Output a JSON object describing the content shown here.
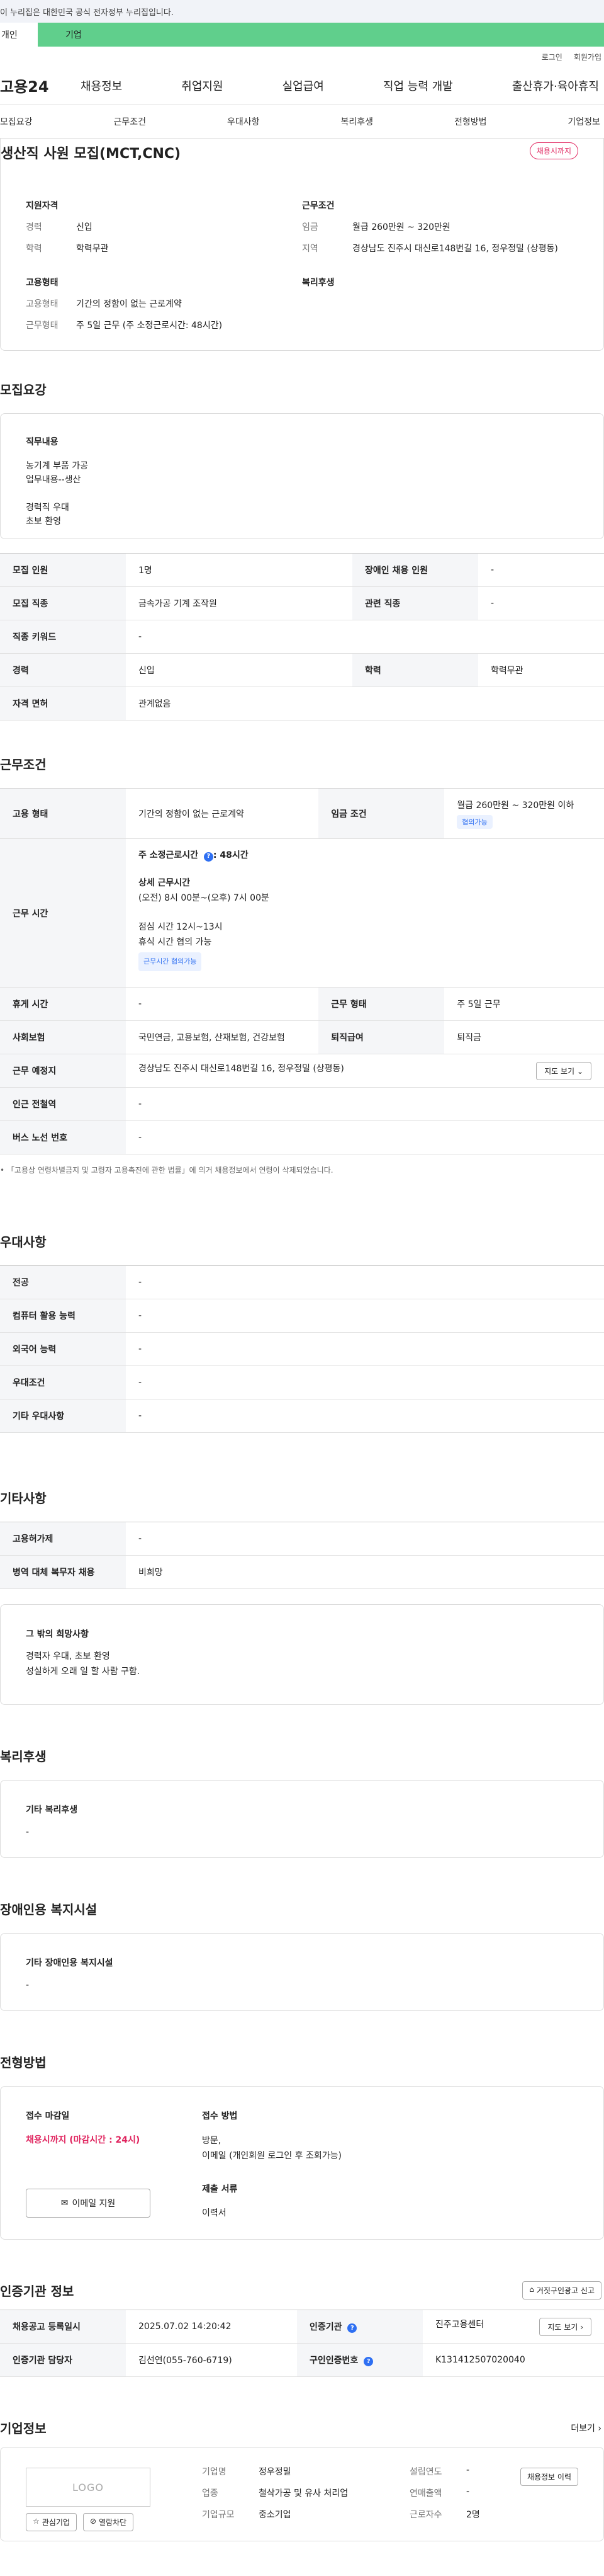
{
  "header": {
    "gov_banner": "이 누리집은 대한민국 공식 전자정부 누리집입니다.",
    "tab_individual": "개인",
    "tab_company": "기업",
    "login": "로그인",
    "signup": "회원가입",
    "logo": "고용24",
    "menu": [
      "채용정보",
      "취업지원",
      "실업급여",
      "직업 능력 개발",
      "출산휴가·육아휴직"
    ]
  },
  "subnav": [
    "모집요강",
    "근무조건",
    "우대사항",
    "복리후생",
    "전형방법",
    "기업정보"
  ],
  "summary": {
    "title": "생산직 사원 모집(MCT,CNC)",
    "badge": "채용시까지",
    "qual_title": "지원자격",
    "career_label": "경력",
    "career": "신입",
    "edu_label": "학력",
    "edu": "학력무관",
    "cond_title": "근무조건",
    "wage_label": "임금",
    "wage": "월급 260만원 ~ 320만원",
    "region_label": "지역",
    "region": "경상남도 진주시 대신로148번길 16, 정우정밀 (상평동)",
    "emp_title": "고용형태",
    "type_label": "고용형태",
    "type": "기간의 정함이 없는 근로계약",
    "shift_label": "근무형태",
    "shift": "주 5일 근무 (주 소정근로시간: 48시간)",
    "welfare_title": "복리후생"
  },
  "recruit": {
    "title": "모집요강",
    "job_title": "직무내용",
    "job_lines": [
      "농기계 부품 가공",
      "업무내용--생산",
      "",
      "경력직 우대",
      "초보 환영"
    ],
    "rows": [
      {
        "k1": "모집 인원",
        "v1": "1명",
        "k2": "장애인 채용 인원",
        "v2": "-"
      },
      {
        "k1": "모집 직종",
        "v1": "금속가공 기계 조작원",
        "k2": "관련 직종",
        "v2": "-"
      },
      {
        "k1": "직종 키워드",
        "v1": "-"
      },
      {
        "k1": "경력",
        "v1": "신입",
        "k2": "학력",
        "v2": "학력무관"
      },
      {
        "k1": "자격 면허",
        "v1": "관계없음"
      }
    ]
  },
  "conditions": {
    "title": "근무조건",
    "emp_type_k": "고용 형태",
    "emp_type_v": "기간의 정함이 없는 근로계약",
    "wage_k": "임금 조건",
    "wage_v": "월급 260만원 ~ 320만원 이하",
    "wage_tag": "협의가능",
    "hours_k": "근무 시간",
    "hours_main": "주 소정근로시간",
    "hours_value": ": 48시간",
    "detail_title": "상세 근무시간",
    "detail_time": "(오전) 8시 00분~(오후) 7시 00분",
    "lunch": "점심 시간 12시~13시",
    "break": "휴식 시간 협의 가능",
    "hours_tag": "근무시간 협의가능",
    "rest_k": "휴게 시간",
    "rest_v": "-",
    "shift_k": "근무 형태",
    "shift_v": "주 5일 근무",
    "insurance_k": "사회보험",
    "insurance_v": "국민연금, 고용보험, 산재보험, 건강보험",
    "severance_k": "퇴직급여",
    "severance_v": "퇴직금",
    "place_k": "근무 예정지",
    "place_v": "경상남도 진주시 대신로148번길 16, 정우정밀 (상평동)",
    "map_btn": "지도 보기",
    "subway_k": "인근 전철역",
    "subway_v": "-",
    "bus_k": "버스 노선 번호",
    "bus_v": "-",
    "note": "「고용상 연령차별금지 및 고령자 고용촉진에 관한 법률」에 의거 채용정보에서 연령이 삭제되었습니다."
  },
  "preference": {
    "title": "우대사항",
    "rows": [
      {
        "k": "전공",
        "v": "-"
      },
      {
        "k": "컴퓨터 활용 능력",
        "v": "-"
      },
      {
        "k": "외국어 능력",
        "v": "-"
      },
      {
        "k": "우대조건",
        "v": "-"
      },
      {
        "k": "기타 우대사항",
        "v": "-"
      }
    ]
  },
  "etc": {
    "title": "기타사항",
    "rows": [
      {
        "k": "고용허가제",
        "v": "-"
      },
      {
        "k": "병역 대체 복무자 채용",
        "v": "비희망"
      }
    ],
    "wish_title": "그 밖의 희망사항",
    "wish_lines": [
      "경력자 우대, 초보 환영",
      "성실하게 오래 일 할 사람 구함."
    ]
  },
  "welfare": {
    "title": "복리후생",
    "box_title": "기타 복리후생",
    "box_value": "-"
  },
  "disability": {
    "title": "장애인용 복지시설",
    "box_title": "기타 장애인용 복지시설",
    "box_value": "-"
  },
  "selection": {
    "title": "전형방법",
    "deadline_title": "접수 마감일",
    "deadline": "채용시까지 (마감시간 : 24시)",
    "method_title": "접수 방법",
    "method_lines": [
      "방문,",
      "이메일 (개인회원 로그인 후 조회가능)"
    ],
    "docs_title": "제출 서류",
    "docs": "이력서",
    "email_btn": "이메일 지원"
  },
  "agency": {
    "title": "인증기관 정보",
    "report_btn": "거짓구인광고 신고",
    "reg_k": "채용공고 등록일시",
    "reg_v": "2025.07.02 14:20:42",
    "org_k": "인증기관",
    "org_v": "진주고용센터",
    "map_btn": "지도 보기",
    "staff_k": "인증기관 담당자",
    "staff_v": "김선연(055-760-6719)",
    "no_k": "구인인증번호",
    "no_v": "K131412507020040"
  },
  "company": {
    "title": "기업정보",
    "more": "더보기",
    "logo_placeholder": "LOGO",
    "fav_btn": "관심기업",
    "block_btn": "열람차단",
    "history_btn": "채용정보 이력",
    "name_k": "기업명",
    "name_v": "정우정밀",
    "industry_k": "업종",
    "industry_v": "철삭가공 및 유사 처리업",
    "size_k": "기업규모",
    "size_v": "중소기업",
    "year_k": "설립연도",
    "year_v": "-",
    "sales_k": "연매출액",
    "sales_v": "-",
    "emp_k": "근로자수",
    "emp_v": "2명"
  }
}
